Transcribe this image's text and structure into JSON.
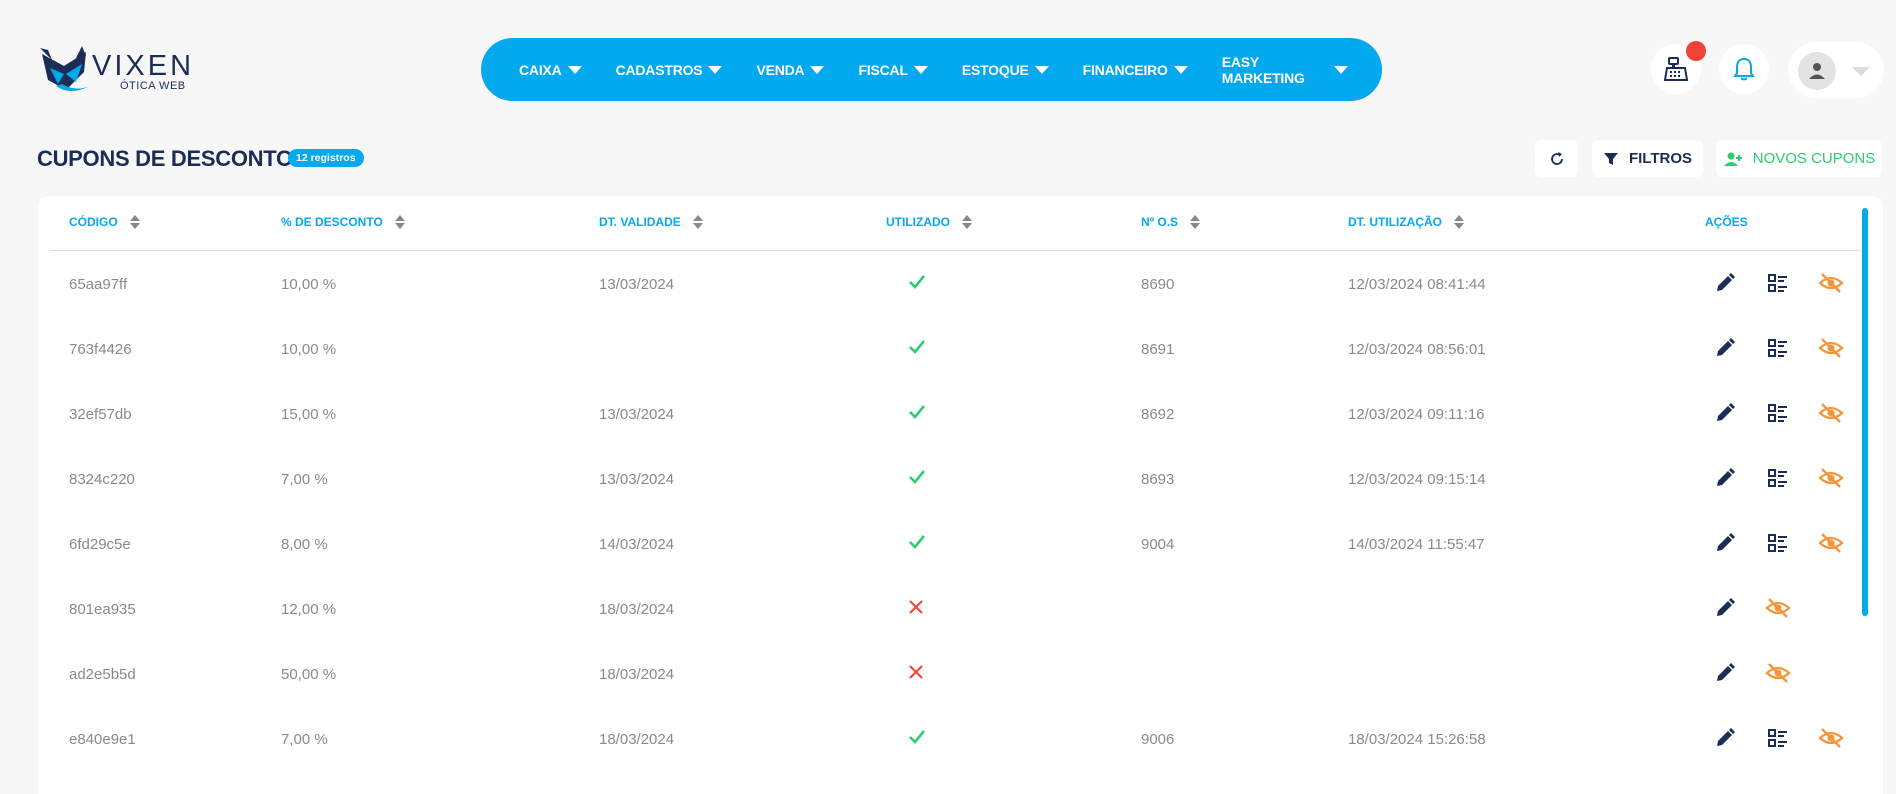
{
  "brand": {
    "name": "VIXEN",
    "subtitle": "ÓTICA WEB"
  },
  "nav": [
    {
      "label": "CAIXA"
    },
    {
      "label": "CADASTROS"
    },
    {
      "label": "VENDA"
    },
    {
      "label": "FISCAL"
    },
    {
      "label": "ESTOQUE"
    },
    {
      "label": "FINANCEIRO"
    },
    {
      "label": "EASY MARKETING"
    }
  ],
  "page": {
    "title": "CUPONS DE DESCONTO",
    "count_badge": "12 registros"
  },
  "toolbar": {
    "filter_label": "FILTROS",
    "new_label": "NOVOS CUPONS"
  },
  "table": {
    "headers": {
      "code": "CÓDIGO",
      "discount": "% DE DESCONTO",
      "validity": "DT. VALIDADE",
      "used": "UTILIZADO",
      "os": "Nº O.S",
      "used_at": "DT. UTILIZAÇÃO",
      "actions": "AÇÕES"
    },
    "rows": [
      {
        "code": "65aa97ff",
        "discount": "10,00 %",
        "validity": "13/03/2024",
        "used": true,
        "os": "8690",
        "used_at": "12/03/2024 08:41:44"
      },
      {
        "code": "763f4426",
        "discount": "10,00 %",
        "validity": "",
        "used": true,
        "os": "8691",
        "used_at": "12/03/2024 08:56:01"
      },
      {
        "code": "32ef57db",
        "discount": "15,00 %",
        "validity": "13/03/2024",
        "used": true,
        "os": "8692",
        "used_at": "12/03/2024 09:11:16"
      },
      {
        "code": "8324c220",
        "discount": "7,00 %",
        "validity": "13/03/2024",
        "used": true,
        "os": "8693",
        "used_at": "12/03/2024 09:15:14"
      },
      {
        "code": "6fd29c5e",
        "discount": "8,00 %",
        "validity": "14/03/2024",
        "used": true,
        "os": "9004",
        "used_at": "14/03/2024 11:55:47"
      },
      {
        "code": "801ea935",
        "discount": "12,00 %",
        "validity": "18/03/2024",
        "used": false,
        "os": "",
        "used_at": ""
      },
      {
        "code": "ad2e5b5d",
        "discount": "50,00 %",
        "validity": "18/03/2024",
        "used": false,
        "os": "",
        "used_at": ""
      },
      {
        "code": "e840e9e1",
        "discount": "7,00 %",
        "validity": "18/03/2024",
        "used": true,
        "os": "9006",
        "used_at": "18/03/2024 15:26:58"
      }
    ]
  },
  "colors": {
    "primary": "#03a9ef",
    "navy": "#1b2d57",
    "success": "#2ecc71",
    "danger": "#f44336",
    "warning": "#f5953a"
  }
}
